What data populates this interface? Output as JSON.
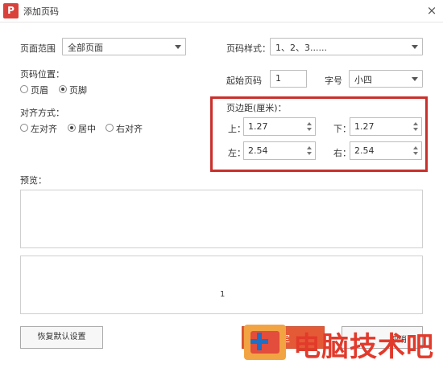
{
  "window": {
    "title": "添加页码",
    "close_glyph": "×"
  },
  "form": {
    "range_label": "页面范围",
    "range_value": "全部页面",
    "style_label": "页码样式：",
    "style_value": "1、2、3......",
    "position_label": "页码位置：",
    "position_options": [
      "页眉",
      "页脚"
    ],
    "position_selected": "页脚",
    "start_label": "起始页码",
    "start_value": "1",
    "size_label": "字号",
    "size_value": "小四",
    "align_label": "对齐方式：",
    "align_options": [
      "左对齐",
      "居中",
      "右对齐"
    ],
    "align_selected": "居中",
    "margin_label": "页边距(厘米)：",
    "margin_top_label": "上：",
    "margin_top_value": "1.27",
    "margin_bottom_label": "下：",
    "margin_bottom_value": "1.27",
    "margin_left_label": "左：",
    "margin_left_value": "2.54",
    "margin_right_label": "右：",
    "margin_right_value": "2.54"
  },
  "preview": {
    "label": "预览：",
    "page_number": "1"
  },
  "buttons": {
    "restore_label": "恢复默认设置",
    "ok_label": "定",
    "cancel_label": "取消"
  },
  "watermark": {
    "text": "电脑技术吧"
  },
  "colors": {
    "highlight_border": "#c9302c",
    "app_icon": "#d9413a",
    "watermark_text": "#e23a2b"
  }
}
